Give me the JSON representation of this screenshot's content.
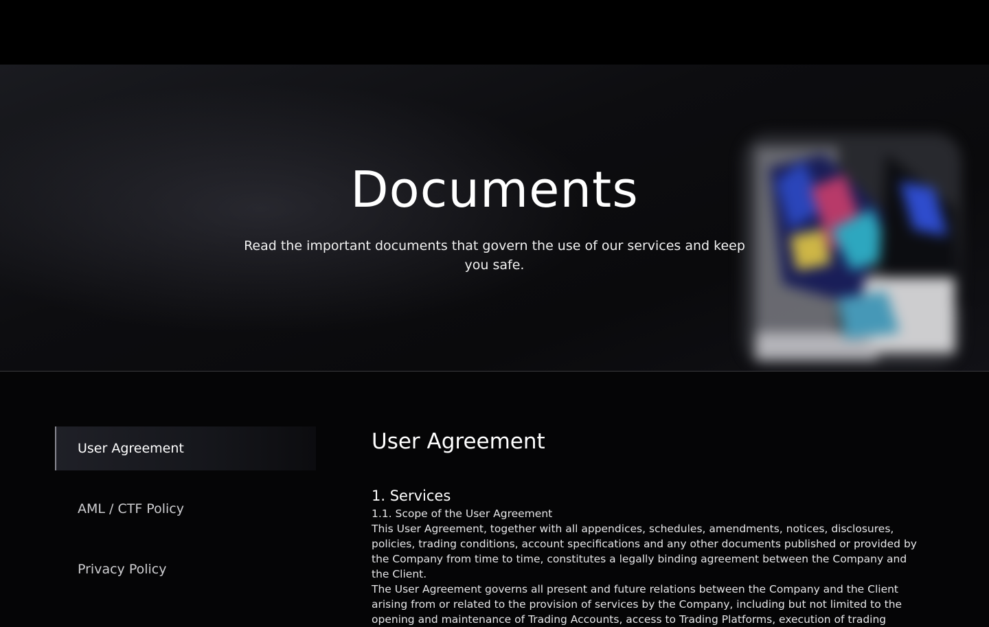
{
  "hero": {
    "title": "Documents",
    "subtitle": "Read the important documents that govern the use of our services and keep you safe."
  },
  "sidebar": {
    "items": [
      {
        "label": "User Agreement",
        "active": true
      },
      {
        "label": "AML / CTF Policy",
        "active": false
      },
      {
        "label": "Privacy Policy",
        "active": false
      }
    ]
  },
  "content": {
    "title": "User Agreement",
    "section_heading": "1. Services",
    "subsection": "1.1. Scope of the User Agreement",
    "paragraph_1": "This User Agreement, together with all appendices, schedules, amendments, notices, disclosures, policies, trading conditions, account specifications and any other documents published or provided by the Company from time to time, constitutes a legally binding agreement between the Company and the Client.",
    "paragraph_2": "The User Agreement governs all present and future relations between the Company and the Client arising from or related to the provision of services by the Company, including but not limited to the opening and maintenance of Trading Accounts, access to Trading Platforms, execution of trading"
  },
  "colors": {
    "background": "#050506",
    "topbar": "#000000",
    "text": "#ffffff",
    "active_indicator": "#8a8a92"
  }
}
